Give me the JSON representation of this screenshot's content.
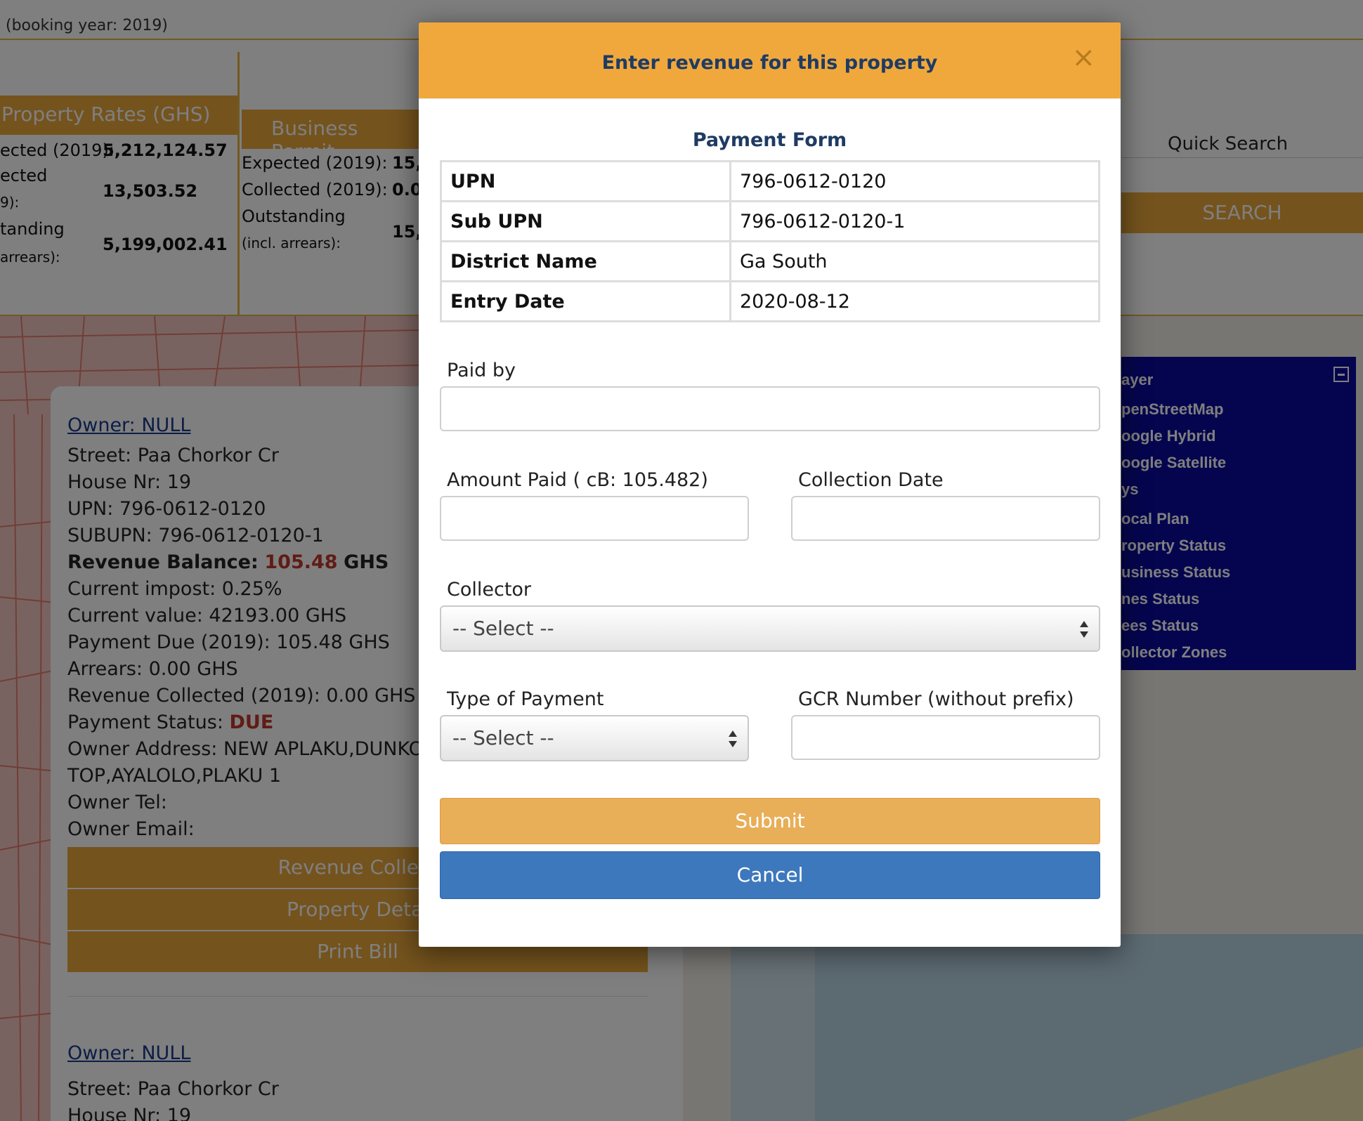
{
  "page": {
    "booking_year": "(booking year: 2019)",
    "property_rates": {
      "header": "Property Rates (GHS)",
      "expected_label": "ected (2019):",
      "expected_value": "5,212,124.57",
      "collected_label_1": "ected",
      "collected_label_2": "9):",
      "collected_value": "13,503.52",
      "outstanding_label_1": "tanding",
      "outstanding_label_2": " arrears):",
      "outstanding_value": "5,199,002.41"
    },
    "business_permit": {
      "header": "Business Permit",
      "expected_label": "Expected (2019):",
      "expected_value": "15,",
      "collected_label": "Collected (2019):",
      "collected_value": "0.0",
      "outstanding_label_1": "Outstanding",
      "outstanding_label_2": "(incl. arrears):",
      "outstanding_value": "15,"
    },
    "quick_search": {
      "label": "Quick Search",
      "button": "SEARCH"
    },
    "layer_panel": {
      "title": "ayer",
      "items": [
        "penStreetMap",
        "oogle Hybrid",
        "oogle Satellite",
        "ys",
        "ocal Plan",
        "roperty Status",
        "usiness Status",
        "nes Status",
        "ees Status",
        "ollector Zones"
      ]
    },
    "property_card": {
      "owner": "Owner: NULL",
      "street": "Street: Paa Chorkor Cr",
      "house": "House Nr: 19",
      "upn": "UPN: 796-0612-0120",
      "subupn": "SUBUPN: 796-0612-0120-1",
      "balance_label": "Revenue Balance:",
      "balance_value": "105.48",
      "balance_unit": "GHS",
      "impost": "Current impost: 0.25%",
      "value": "Current value: 42193.00 GHS",
      "payment_due": "Payment Due (2019): 105.48 GHS",
      "arrears": "Arrears: 0.00 GHS",
      "collected": "Revenue Collected (2019): 0.00 GHS",
      "status_label": "Payment Status:",
      "status_value": "DUE",
      "address_1": "Owner Address: NEW APLAKU,DUNKONA",
      "address_2": "TOP,AYALOLO,PLAKU 1",
      "tel": "Owner Tel:",
      "email": "Owner Email:",
      "btn_revenue": "Revenue Collect",
      "btn_details": "Property Detai",
      "btn_print": "Print Bill"
    },
    "property_card_2": {
      "owner": "Owner: NULL",
      "street": "Street: Paa Chorkor Cr",
      "house": "House Nr: 19"
    }
  },
  "modal": {
    "title": "Enter revenue for this property",
    "close": "×",
    "form_title": "Payment Form",
    "rows": [
      {
        "key": "UPN",
        "value": "796-0612-0120"
      },
      {
        "key": "Sub UPN",
        "value": "796-0612-0120-1"
      },
      {
        "key": "District Name",
        "value": "Ga South"
      },
      {
        "key": "Entry Date",
        "value": "2020-08-12"
      }
    ],
    "paid_by_label": "Paid by",
    "amount_label": "Amount Paid ( cB: 105.482)",
    "collection_date_label": "Collection Date",
    "collector_label": "Collector",
    "collector_value": "-- Select --",
    "payment_type_label": "Type of Payment",
    "payment_type_value": "-- Select --",
    "gcr_label": "GCR Number (without prefix)",
    "submit": "Submit",
    "cancel": "Cancel"
  },
  "colors": {
    "accent": "#f0a83d",
    "title": "#1f3b63",
    "cancel": "#3d78bd",
    "due": "#c0392b"
  }
}
